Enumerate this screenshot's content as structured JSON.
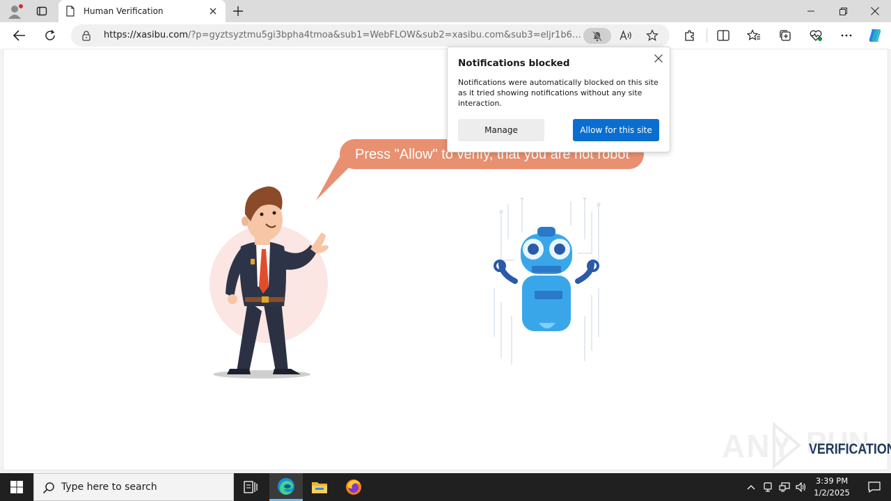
{
  "browser": {
    "tab_title": "Human Verification",
    "url_host": "https://xasibu.com",
    "url_rest": "/?p=gyztsyztmu5gi3bpha4tmoa&sub1=WebFLOW&sub2=xasibu.com&sub3=eljr1b64e4uf..."
  },
  "popup": {
    "title": "Notifications blocked",
    "body": "Notifications were automatically blocked on this site as it tried showing notifications without any site interaction.",
    "manage_label": "Manage",
    "allow_label": "Allow for this site"
  },
  "page": {
    "bubble_text": "Press \"Allow\" to verify, that you are not robot",
    "watermark_any": "ANY",
    "watermark_verification": "VERIFICATION"
  },
  "taskbar": {
    "search_placeholder": "Type here to search",
    "time": "3:39 PM",
    "date": "1/2/2025"
  },
  "colors": {
    "accent_blue": "#0a6ed1",
    "bubble": "#e8906f",
    "taskbar": "#202020"
  }
}
